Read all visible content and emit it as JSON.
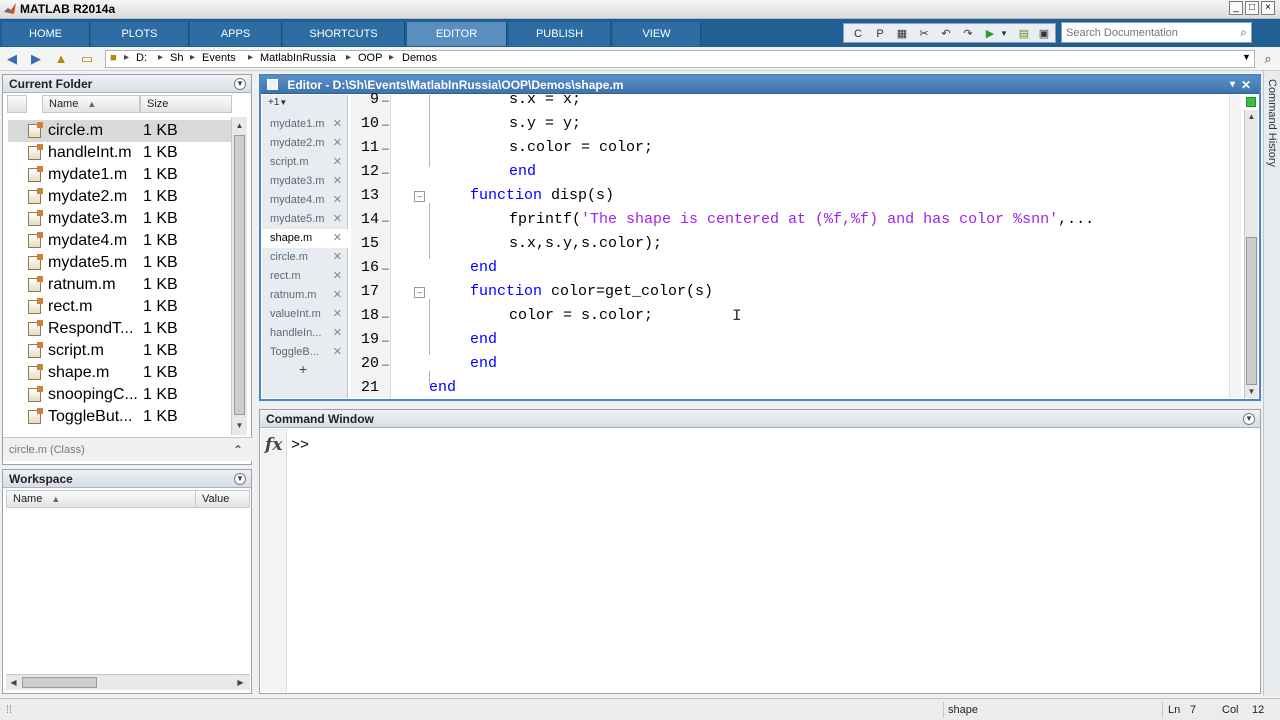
{
  "window": {
    "title": "MATLAB R2014a",
    "controls": [
      "_",
      "□",
      "×"
    ]
  },
  "ribbon": {
    "tabs": [
      {
        "label": "HOME"
      },
      {
        "label": "PLOTS"
      },
      {
        "label": "APPS"
      },
      {
        "label": "SHORTCUTS"
      },
      {
        "label": "EDITOR"
      },
      {
        "label": "PUBLISH"
      },
      {
        "label": "VIEW"
      }
    ],
    "active_tab": "EDITOR",
    "search_placeholder": "Search Documentation"
  },
  "address": {
    "crumbs": [
      "D:",
      "Sh",
      "Events",
      "MatlabInRussia",
      "OOP",
      "Demos"
    ]
  },
  "current_folder": {
    "title": "Current Folder",
    "col_name": "Name",
    "col_size": "Size",
    "files": [
      {
        "name": "circle.m",
        "size": "1 KB"
      },
      {
        "name": "handleInt.m",
        "size": "1 KB"
      },
      {
        "name": "mydate1.m",
        "size": "1 KB"
      },
      {
        "name": "mydate2.m",
        "size": "1 KB"
      },
      {
        "name": "mydate3.m",
        "size": "1 KB"
      },
      {
        "name": "mydate4.m",
        "size": "1 KB"
      },
      {
        "name": "mydate5.m",
        "size": "1 KB"
      },
      {
        "name": "ratnum.m",
        "size": "1 KB"
      },
      {
        "name": "rect.m",
        "size": "1 KB"
      },
      {
        "name": "RespondT...",
        "size": "1 KB"
      },
      {
        "name": "script.m",
        "size": "1 KB"
      },
      {
        "name": "shape.m",
        "size": "1 KB"
      },
      {
        "name": "snoopingC...",
        "size": "1 KB"
      },
      {
        "name": "ToggleBut...",
        "size": "1 KB"
      }
    ],
    "selected": "circle.m",
    "detail": "circle.m (Class)"
  },
  "workspace": {
    "title": "Workspace",
    "col_name": "Name",
    "col_value": "Value"
  },
  "editor": {
    "title": "Editor - D:\\Sh\\Events\\MatlabInRussia\\OOP\\Demos\\shape.m",
    "tab_count_label": "+1",
    "doc_tabs": [
      "mydate1.m",
      "mydate2.m",
      "script.m",
      "mydate3.m",
      "mydate4.m",
      "mydate5.m",
      "shape.m",
      "circle.m",
      "rect.m",
      "ratnum.m",
      "valueInt.m",
      "handleIn...",
      "ToggleB..."
    ],
    "active_doc": "shape.m",
    "add_tab": "+",
    "lines": [
      {
        "num": "9",
        "dash": "–"
      },
      {
        "num": "10",
        "dash": "–"
      },
      {
        "num": "11",
        "dash": "–"
      },
      {
        "num": "12",
        "dash": "–"
      },
      {
        "num": "13",
        "dash": ""
      },
      {
        "num": "14",
        "dash": "–"
      },
      {
        "num": "15",
        "dash": ""
      },
      {
        "num": "16",
        "dash": "–"
      },
      {
        "num": "17",
        "dash": ""
      },
      {
        "num": "18",
        "dash": "–"
      },
      {
        "num": "19",
        "dash": "–"
      },
      {
        "num": "20",
        "dash": "–"
      },
      {
        "num": "21",
        "dash": ""
      }
    ],
    "code": {
      "l9": "s.x = x;",
      "l10": "s.y = y;",
      "l11": "s.color = color;",
      "l12_kw": "end",
      "l13_kw": "function",
      "l13_rest": " disp(s)",
      "l14_a": "fprintf(",
      "l14_str": "'The shape is centered at (%f,%f) and has color %snn'",
      "l14_b": ",...",
      "l15": "s.x,s.y,s.color);",
      "l16_kw": "end",
      "l17_kw": "function",
      "l17_rest": " color=get_color(s)",
      "l18": "color = s.color;",
      "l19_kw": "end",
      "l20_kw": "end",
      "l21_kw": "end"
    }
  },
  "command_window": {
    "title": "Command Window",
    "fx": "fx",
    "prompt": ">>"
  },
  "side_panel": {
    "label": "Command History"
  },
  "status_bar": {
    "file": "shape",
    "ln_label": "Ln",
    "ln": "7",
    "col_label": "Col",
    "col": "12"
  }
}
